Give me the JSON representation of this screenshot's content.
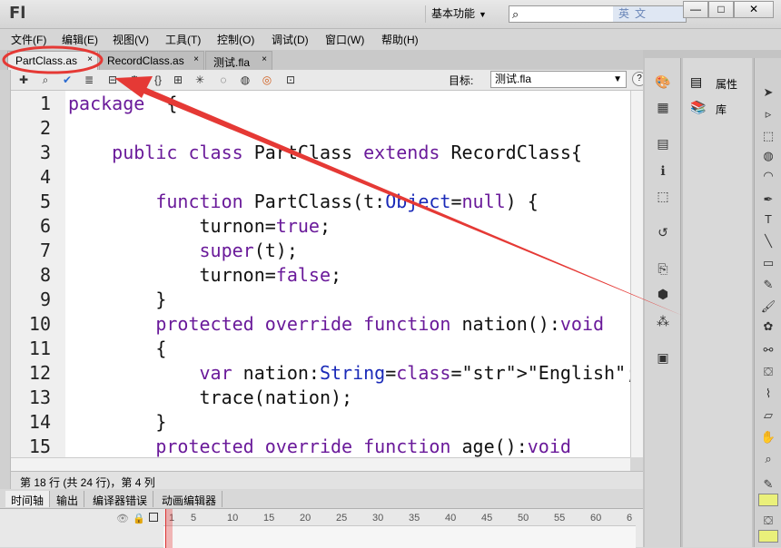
{
  "app": {
    "logo": "Fl",
    "workspace": "基本功能",
    "ime_text": "英文",
    "search_icon": "search-icon"
  },
  "window_controls": {
    "minimize": "—",
    "maximize": "□",
    "close": "✕"
  },
  "menu": [
    "文件(F)",
    "编辑(E)",
    "视图(V)",
    "工具(T)",
    "控制(O)",
    "调试(D)",
    "窗口(W)",
    "帮助(H)"
  ],
  "tabs": [
    {
      "label": "PartClass.as",
      "close": "×"
    },
    {
      "label": "RecordClass.as",
      "close": "×"
    },
    {
      "label": "测试.fla",
      "close": "×"
    }
  ],
  "toolbar": {
    "target_label": "目标:",
    "target_value": "测试.fla",
    "help": "?"
  },
  "editor": {
    "line_numbers": [
      "1",
      "2",
      "3",
      "4",
      "5",
      "6",
      "7",
      "8",
      "9",
      "10",
      "11",
      "12",
      "13",
      "14",
      "15"
    ],
    "lines": [
      "package  {",
      "",
      "    public class PartClass extends RecordClass{",
      "",
      "        function PartClass(t:Object=null) {",
      "            turnon=true;",
      "            super(t);",
      "            turnon=false;",
      "        }",
      "        protected override function nation():void",
      "        {",
      "            var nation:String=\"English\";",
      "            trace(nation);",
      "        }",
      "        protected override function age():void"
    ]
  },
  "status": {
    "text": "第 18 行 (共 24 行)，第 4 列"
  },
  "bottom_tabs": [
    "时间轴",
    "输出",
    "编译器错误",
    "动画编辑器"
  ],
  "timeline": {
    "frame_numbers": [
      "1",
      "5",
      "10",
      "15",
      "20",
      "25",
      "30",
      "35",
      "40",
      "45",
      "50",
      "55",
      "60",
      "6"
    ]
  },
  "right_panels": {
    "properties": "属性",
    "library": "库"
  },
  "colors": {
    "annotation": "#e53935",
    "keyword": "#6a1a9a",
    "string": "#1a8a2a",
    "class": "#1a2ab8"
  }
}
